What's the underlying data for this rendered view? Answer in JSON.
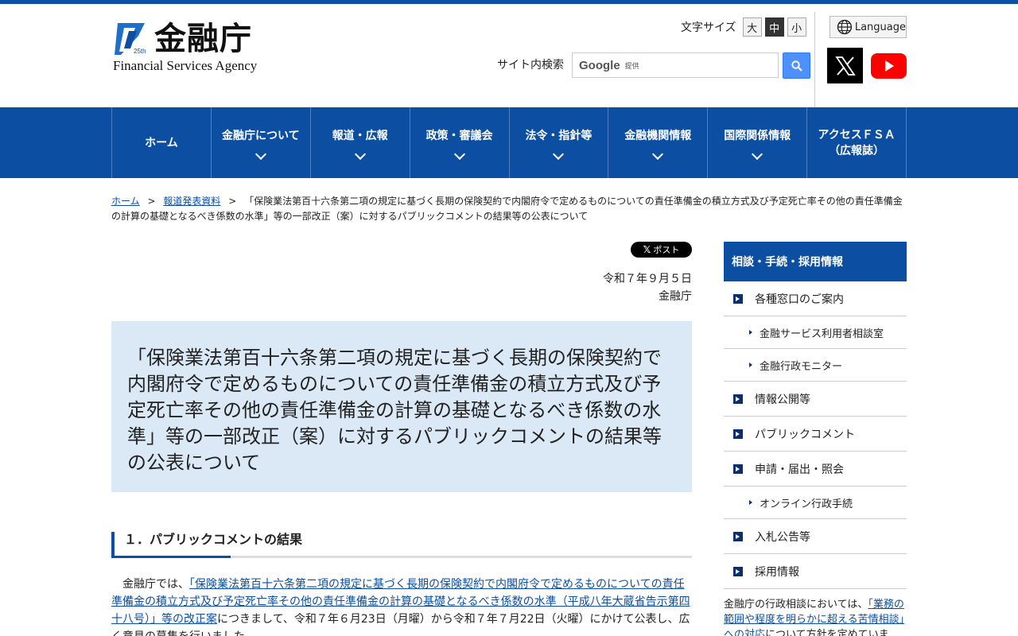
{
  "logo": {
    "title": "金融庁",
    "subtitle": "Financial Services Agency"
  },
  "fontsize": {
    "label": "文字サイズ",
    "large": "大",
    "medium": "中",
    "small": "小"
  },
  "language": {
    "label": "Language"
  },
  "search": {
    "label": "サイト内検索",
    "google": "Google",
    "provided": "提供"
  },
  "nav": {
    "items": [
      {
        "label": "ホーム"
      },
      {
        "label": "金融庁について"
      },
      {
        "label": "報道・広報"
      },
      {
        "label": "政策・審議会"
      },
      {
        "label": "法令・指針等"
      },
      {
        "label": "金融機関情報"
      },
      {
        "label": "国際関係情報"
      },
      {
        "label1": "アクセスＦＳＡ",
        "label2": "（広報誌）"
      }
    ]
  },
  "breadcrumb": {
    "home": "ホーム",
    "sep": ">",
    "press": "報道発表資料",
    "current": "「保険業法第百十六条第二項の規定に基づく長期の保険契約で内閣府令で定めるものについての責任準備金の積立方式及び予定死亡率その他の責任準備金の計算の基礎となるべき係数の水準」等の一部改正（案）に対するパブリックコメントの結果等の公表について"
  },
  "post_button": "ポスト",
  "date": {
    "date": "令和７年９月５日",
    "agency": "金融庁"
  },
  "title": "「保険業法第百十六条第二項の規定に基づく長期の保険契約で内閣府令で定めるものについての責任準備金の積立方式及び予定死亡率その他の責任準備金の計算の基礎となるべき係数の水準」等の一部改正（案）に対するパブリックコメントの結果等の公表について",
  "section1": {
    "heading": "１．パブリックコメントの結果"
  },
  "body": {
    "prefix": "　金融庁では、",
    "link": "「保険業法第百十六条第二項の規定に基づく長期の保険契約で内閣府令で定めるものについての責任準備金の積立方式及び予定死亡率その他の責任準備金の計算の基礎となるべき係数の水準（平成八年大蔵省告示第四十八号）」等の改正案",
    "suffix": "につきまして、令和７年６月23日（月曜）から令和７年７月22日（火曜）にかけて公表し、広く意見の募集を行いました。"
  },
  "sidebar": {
    "heading": "相談・手続・採用情報",
    "item1": "各種窓口のご案内",
    "sub1": "金融サービス利用者相談室",
    "sub2": "金融行政モニター",
    "item2": "情報公開等",
    "item3": "パブリックコメント",
    "item4": "申請・届出・照会",
    "sub3": "オンライン行政手続",
    "item5": "入札公告等",
    "item6": "採用情報",
    "note_prefix": "金融庁の行政相談においては、",
    "note_link": "「業務の範囲や程度を明らかに超える苦情相談」への対応",
    "note_suffix": "について方針を定めています。"
  }
}
